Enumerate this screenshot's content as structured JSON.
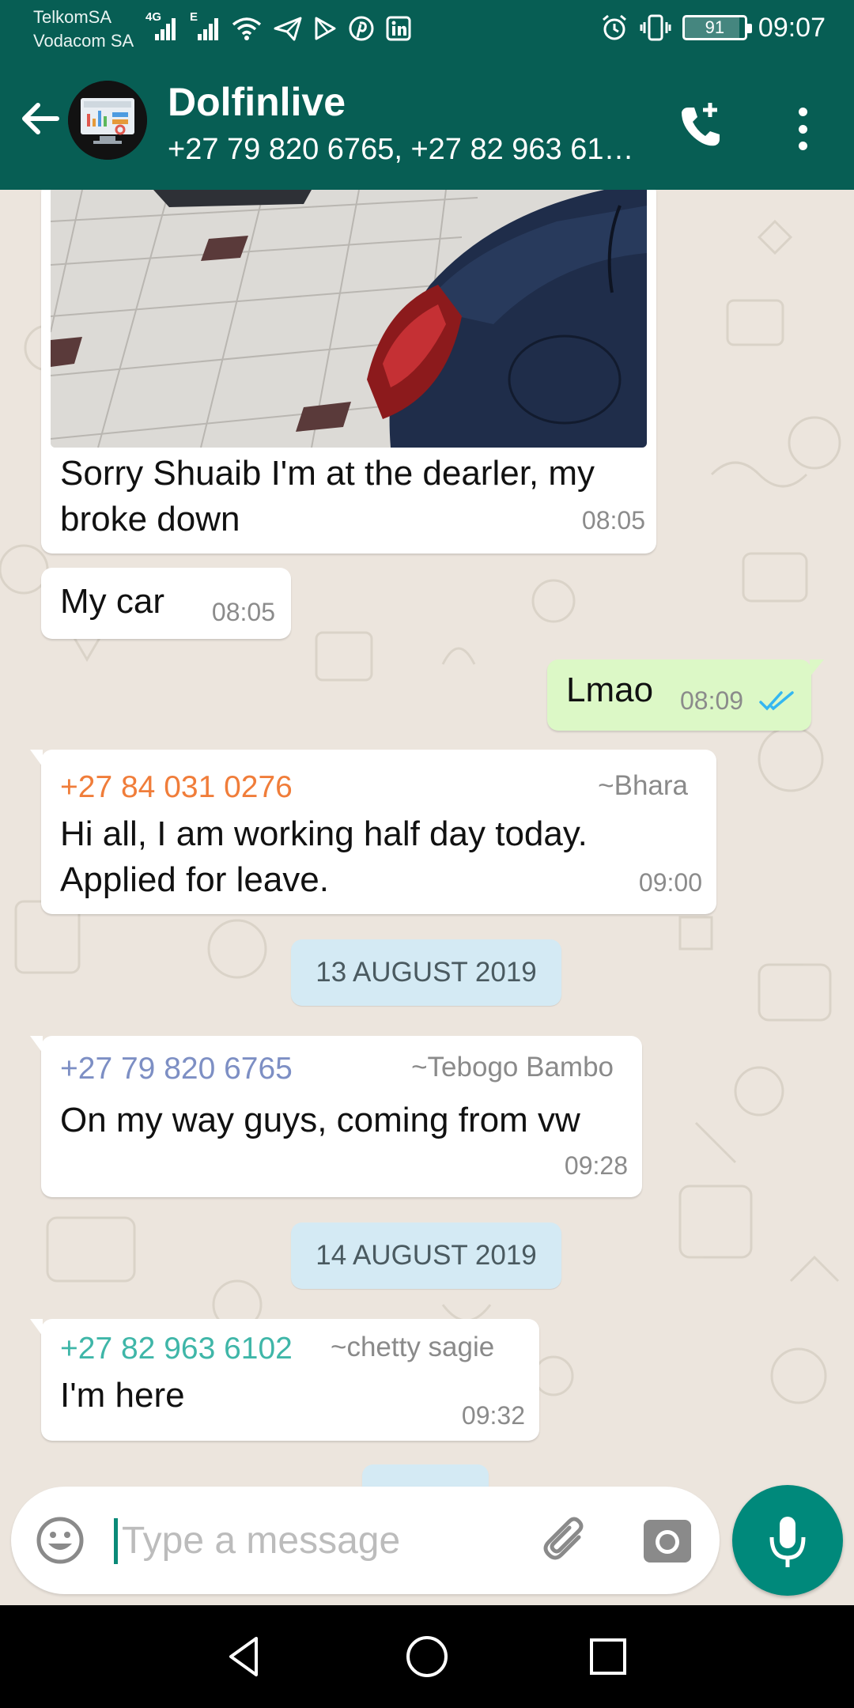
{
  "status_bar": {
    "carrier_1": "TelkomSA",
    "carrier_2": "Vodacom SA",
    "network_1": "4G",
    "network_2": "E",
    "battery": "91",
    "battery_level": 0.91,
    "time": "09:07",
    "icons": [
      "signal-icon",
      "wifi-icon",
      "telegram-icon",
      "play-store-icon",
      "pinterest-icon",
      "linkedin-icon",
      "alarm-icon",
      "vibrate-icon",
      "battery-icon"
    ]
  },
  "header": {
    "title": "Dolfinlive",
    "subtitle": "+27 79 820 6765, +27 82 963 61…",
    "icons": [
      "back-arrow-icon",
      "add-call-icon",
      "more-options-icon"
    ]
  },
  "messages": [
    {
      "type": "image_caption",
      "direction": "in",
      "text_line_1": "Sorry Shuaib I'm at the dearler, my",
      "text_line_2": "broke down",
      "time": "08:05"
    },
    {
      "type": "text",
      "direction": "in",
      "text": "My car",
      "time": "08:05"
    },
    {
      "type": "text",
      "direction": "out",
      "text": "Lmao",
      "time": "08:09",
      "status": "read"
    },
    {
      "type": "text",
      "direction": "in",
      "sender_phone": "+27 84 031 0276",
      "sender_name": "~Bhara",
      "sender_color": "#f07d3a",
      "text_line_1": "Hi all, I am working half day today.",
      "text_line_2": "Applied for leave.",
      "time": "09:00"
    },
    {
      "type": "date",
      "text": "13 AUGUST 2019"
    },
    {
      "type": "text",
      "direction": "in",
      "sender_phone": "+27 79 820 6765",
      "sender_name": "~Tebogo Bambo",
      "sender_color": "#7d8fc4",
      "text": "On my way guys, coming from vw",
      "time": "09:28"
    },
    {
      "type": "date",
      "text": "14 AUGUST 2019"
    },
    {
      "type": "text",
      "direction": "in",
      "sender_phone": "+27 82 963 6102",
      "sender_name": "~chetty sagie",
      "sender_color": "#3fb6a8",
      "text": "I'm here",
      "time": "09:32"
    }
  ],
  "composer": {
    "placeholder": "Type a message",
    "value": "",
    "icons": [
      "emoji-icon",
      "paperclip-icon",
      "camera-icon",
      "microphone-icon"
    ]
  },
  "nav_bar": {
    "icons": [
      "back-triangle-icon",
      "home-circle-icon",
      "recents-square-icon"
    ]
  },
  "colors": {
    "header": "#075e54",
    "chat_background": "#ece5dd",
    "outgoing_bubble": "#dcf8c6",
    "incoming_bubble": "#ffffff",
    "date_chip": "#d4eaf4",
    "mic_button": "#00897b",
    "read_ticks": "#34b7f1"
  }
}
